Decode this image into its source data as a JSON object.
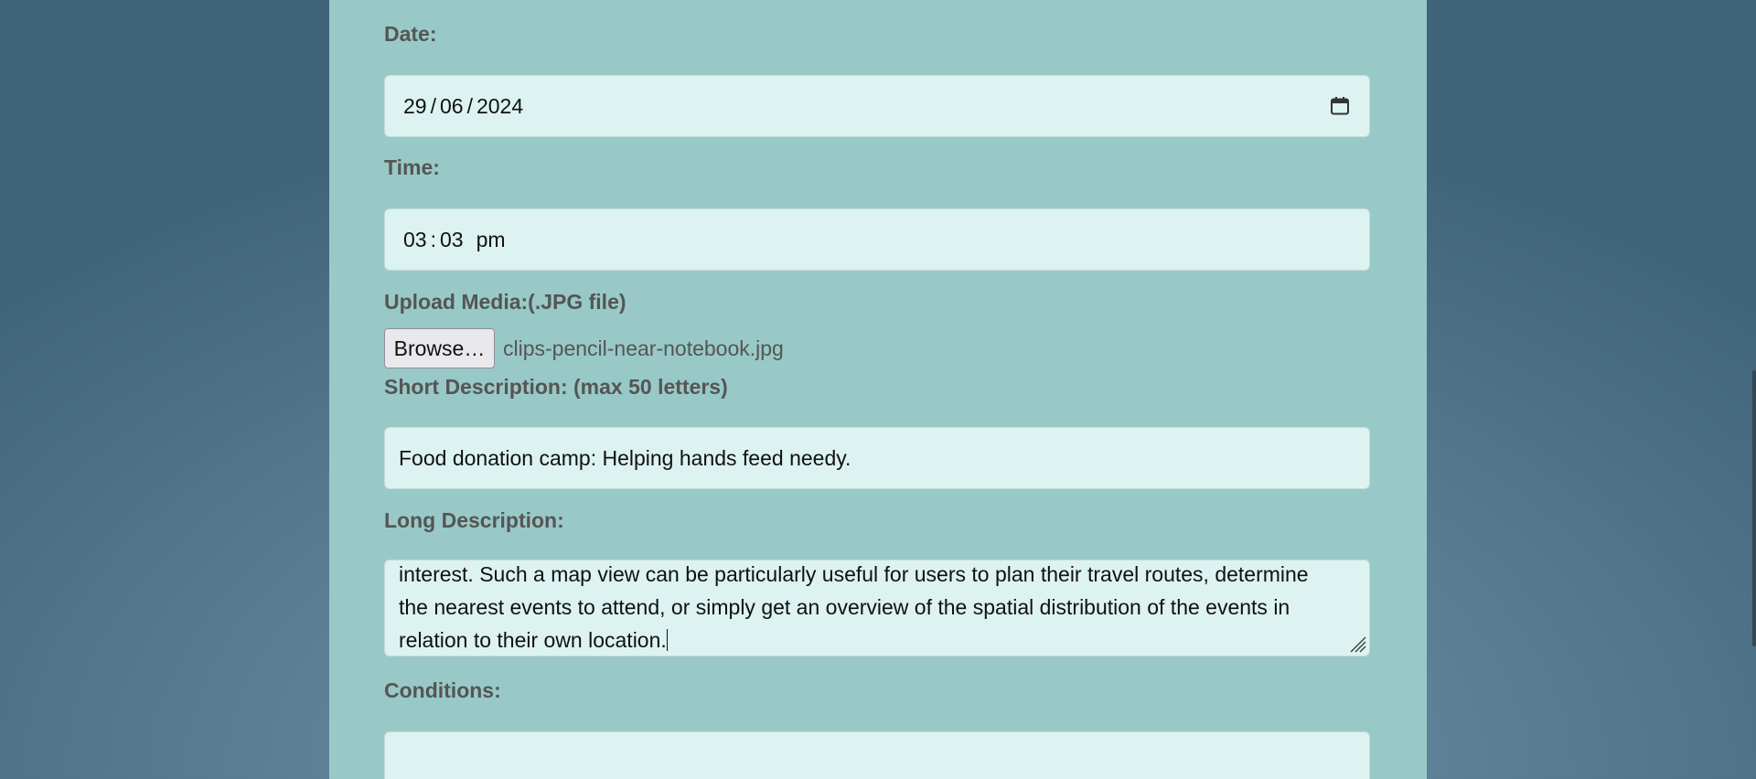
{
  "form": {
    "date": {
      "label": "Date:",
      "day": "29",
      "month": "06",
      "year": "2024",
      "separator": "/",
      "icon": "calendar-icon"
    },
    "time": {
      "label": "Time:",
      "hour": "03",
      "minute": "03",
      "separator": ":",
      "period": "pm"
    },
    "upload": {
      "label": "Upload Media:(.JPG file)",
      "button_label": "Browse…",
      "file_name": "clips-pencil-near-notebook.jpg"
    },
    "short_description": {
      "label": "Short Description: (max 50 letters)",
      "value": "Food donation camp: Helping hands feed needy."
    },
    "long_description": {
      "label": "Long Description:",
      "visible_lines": [
        "interest. Such a map view can be particularly useful for users to plan their travel routes, determine",
        "the nearest events to attend, or simply get an overview of the spatial distribution of the events in",
        "relation to their own location."
      ]
    },
    "conditions": {
      "label": "Conditions:",
      "value": ""
    }
  },
  "colors": {
    "panel_background": "#98c9c7",
    "field_background": "#dcf3f1",
    "label_color": "#555555"
  }
}
